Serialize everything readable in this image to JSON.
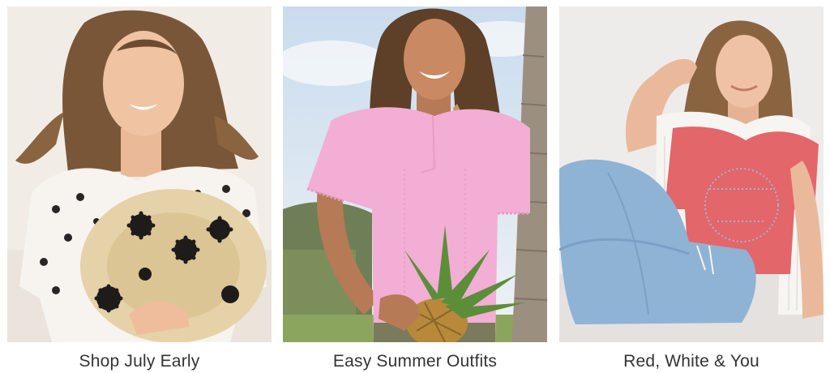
{
  "cards": [
    {
      "caption": "Shop July Early",
      "image": "woman-in-printed-blouse-holding-flower-straw-hat"
    },
    {
      "caption": "Easy Summer Outfits",
      "image": "woman-in-pink-blouse-holding-pineapple"
    },
    {
      "caption": "Red, White & You",
      "image": "woman-in-red-tee-and-wide-leg-jeans-seated"
    }
  ],
  "colors": {
    "caption_text": "#333333",
    "card1_background": "#f1ece6",
    "card2_sky": "#dfe8f1",
    "card3_background": "#eeeceb"
  }
}
